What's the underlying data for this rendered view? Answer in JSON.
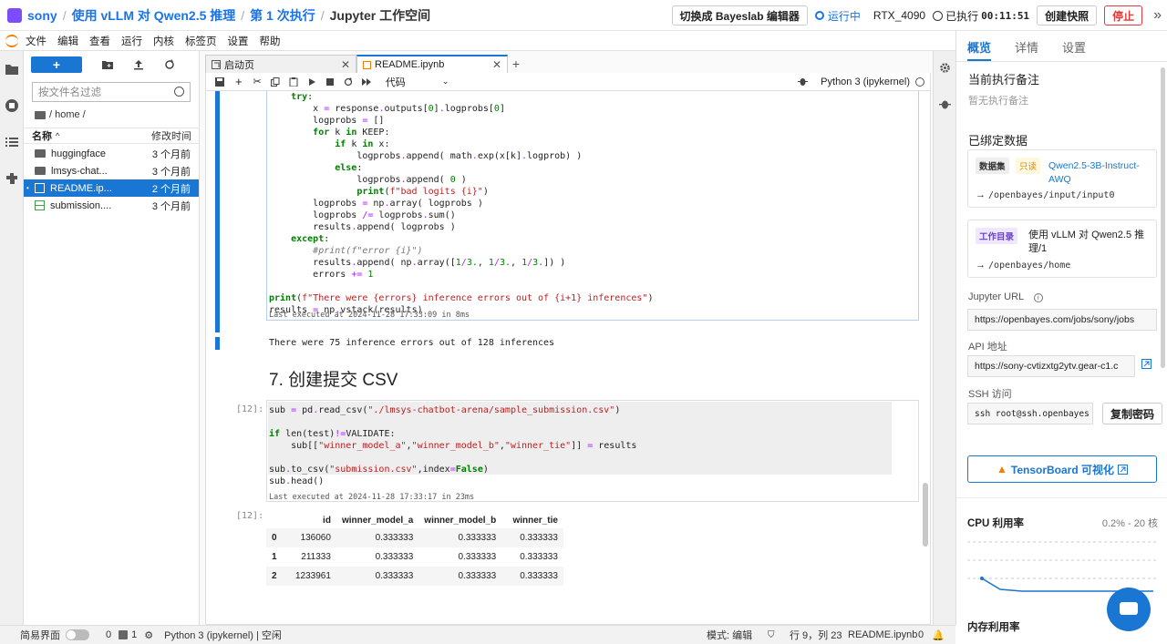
{
  "topbar": {
    "breadcrumbs": [
      "sony",
      "使用 vLLM 对 Qwen2.5 推理",
      "第 1 次执行",
      "Jupyter 工作空间"
    ],
    "switch_editor": "切换成 Bayeslab 编辑器",
    "status": "运行中",
    "gpu": "RTX_4090",
    "executed_label": "已执行",
    "executed_time": "00:11:51",
    "snapshot": "创建快照",
    "stop": "停止",
    "collapse": "»"
  },
  "menubar": {
    "items": [
      "文件",
      "编辑",
      "查看",
      "运行",
      "内核",
      "标签页",
      "设置",
      "帮助"
    ]
  },
  "filebrowser": {
    "new_label": "+",
    "search_placeholder": "按文件名过滤",
    "path": "/ home /",
    "col_name": "名称",
    "col_modified": "修改时间",
    "rows": [
      {
        "name": "huggingface",
        "time": "3 个月前"
      },
      {
        "name": "lmsys-chat...",
        "time": "3 个月前"
      },
      {
        "name": "README.ip...",
        "time": "2 个月前"
      },
      {
        "name": "submission....",
        "time": "3 个月前"
      }
    ]
  },
  "tabs": [
    {
      "label": "启动页"
    },
    {
      "label": "README.ipynb"
    }
  ],
  "nbtoolbar": {
    "celltype": "代码",
    "kernel": "Python 3 (ipykernel)"
  },
  "cells": {
    "cell1_meta": "Last executed at 2024-11-28 17:33:09 in 8ms",
    "cell1_output": "There were 75 inference errors out of 128 inferences",
    "heading": "7. 创建提交 CSV",
    "cell2_prompt": "[12]:",
    "cell2_meta": "Last executed at 2024-11-28 17:33:17 in 23ms",
    "out_prompt": "[12]:"
  },
  "dataframe": {
    "columns": [
      "",
      "id",
      "winner_model_a",
      "winner_model_b",
      "winner_tie"
    ],
    "rows": [
      [
        "0",
        "136060",
        "0.333333",
        "0.333333",
        "0.333333"
      ],
      [
        "1",
        "211333",
        "0.333333",
        "0.333333",
        "0.333333"
      ],
      [
        "2",
        "1233961",
        "0.333333",
        "0.333333",
        "0.333333"
      ]
    ]
  },
  "rpanel": {
    "tabs": [
      "概览",
      "详情",
      "设置"
    ],
    "current_note_title": "当前执行备注",
    "current_note_empty": "暂无执行备注",
    "bound_data_title": "已绑定数据",
    "dataset_tag": "数据集",
    "readonly_tag": "只读",
    "dataset_name": "Qwen2.5-3B-Instruct-AWQ",
    "dataset_path": "/openbayes/input/input0",
    "workdir_tag": "工作目录",
    "workdir_name": "使用 vLLM 对 Qwen2.5 推理/1",
    "workdir_path": "/openbayes/home",
    "jupyter_url_label": "Jupyter URL",
    "jupyter_url": "https://openbayes.com/jobs/sony/jobs",
    "api_label": "API 地址",
    "api_url": "https://sony-cvtizxtg2ytv.gear-c1.c",
    "ssh_label": "SSH 访问",
    "ssh_value": "ssh root@ssh.openbayes",
    "copy_password": "复制密码",
    "tensorboard": "TensorBoard 可视化",
    "cpu_title": "CPU 利用率",
    "cpu_range": "0.2% - 20 核",
    "mem_title": "内存利用率"
  },
  "statusbar": {
    "simple_ui": "简易界面",
    "count1": "0",
    "count2": "1",
    "kernel_status": "Python 3 (ipykernel) | 空闲",
    "mode": "模式: 编辑",
    "position": "行 9，列 23",
    "filename": "README.ipynb",
    "count3": "0"
  },
  "colors": {
    "accent": "#1976d2",
    "stop_red": "#e53935",
    "jupyter_orange": "#f57c00"
  }
}
